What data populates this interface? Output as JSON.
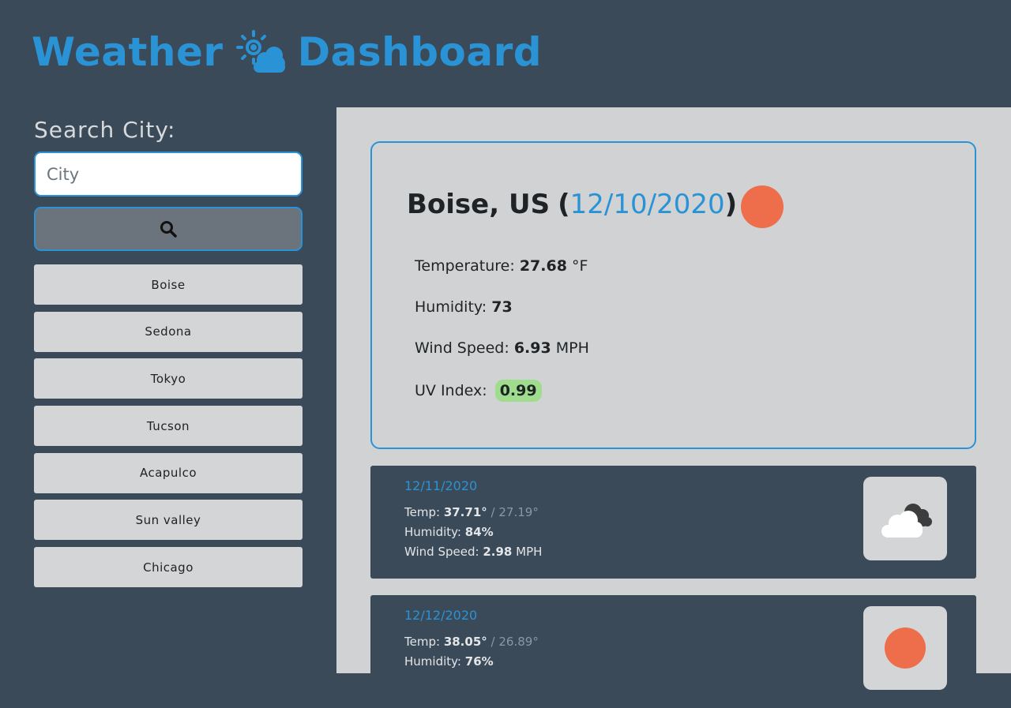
{
  "header": {
    "title_part1": "Weather",
    "title_part2": "Dashboard",
    "logo_icon": "sun-cloud-icon"
  },
  "sidebar": {
    "search_label": "Search City:",
    "search_placeholder": "City",
    "search_value": "",
    "search_button_icon": "search-icon",
    "history": [
      {
        "label": "Boise"
      },
      {
        "label": "Sedona"
      },
      {
        "label": "Tokyo"
      },
      {
        "label": "Tucson"
      },
      {
        "label": "Acapulco"
      },
      {
        "label": "Sun valley"
      },
      {
        "label": "Chicago"
      }
    ]
  },
  "current": {
    "city": "Boise, US",
    "open_paren": "(",
    "date": "12/10/2020",
    "close_paren": ")",
    "icon": "clear-sun-icon",
    "temperature_label": "Temperature:",
    "temperature_value": "27.68",
    "temperature_unit": "°F",
    "humidity_label": "Humidity:",
    "humidity_value": "73",
    "wind_label": "Wind Speed:",
    "wind_value": "6.93",
    "wind_unit": "MPH",
    "uv_label": "UV Index:",
    "uv_value": "0.99",
    "uv_color": "#9fdc8e"
  },
  "forecast": [
    {
      "date": "12/11/2020",
      "temp_label": "Temp:",
      "temp_high": "37.71°",
      "temp_sep": "/",
      "temp_low": "27.19°",
      "humidity_label": "Humidity:",
      "humidity_value": "84%",
      "wind_label": "Wind Speed:",
      "wind_value": "2.98",
      "wind_unit": "MPH",
      "icon": "clouds-icon"
    },
    {
      "date": "12/12/2020",
      "temp_label": "Temp:",
      "temp_high": "38.05°",
      "temp_sep": "/",
      "temp_low": "26.89°",
      "humidity_label": "Humidity:",
      "humidity_value": "76%",
      "icon": "clear-sun-icon"
    }
  ],
  "colors": {
    "accent": "#2a93d5",
    "background_dark": "#3a4a59",
    "main_panel": "#d1d2d3",
    "sun": "#ee6d4a"
  }
}
